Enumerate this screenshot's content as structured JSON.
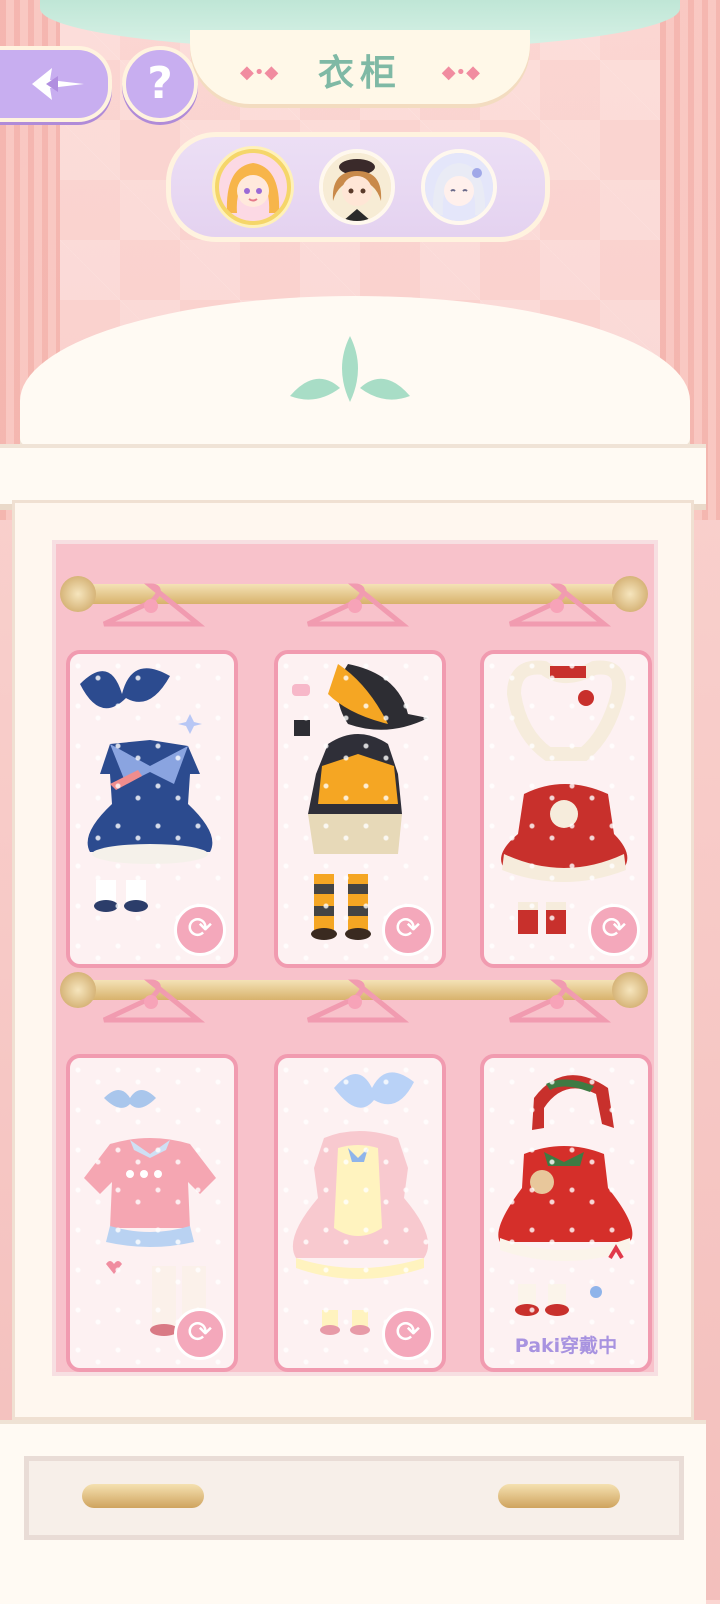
{
  "header": {
    "title": "衣柜"
  },
  "help": {
    "label": "?"
  },
  "avatars": [
    {
      "name": "blonde-girl",
      "selected": true
    },
    {
      "name": "brown-hair-boy",
      "selected": false
    },
    {
      "name": "silver-hair-girl",
      "selected": false
    }
  ],
  "outfits": [
    {
      "name": "navy-sailor-dress",
      "swap_icon": "refresh-icon"
    },
    {
      "name": "witch-halloween-dress",
      "swap_icon": "refresh-icon"
    },
    {
      "name": "red-bunny-winter-dress",
      "swap_icon": "refresh-icon"
    },
    {
      "name": "pink-sweater-outfit",
      "swap_icon": "refresh-icon"
    },
    {
      "name": "pink-apron-dress",
      "swap_icon": "refresh-icon"
    },
    {
      "name": "christmas-red-dress",
      "status": "Paki穿戴中"
    }
  ],
  "swap_glyph": "⟳",
  "colors": {
    "accent": "#c8aef0",
    "card_border": "#f19bb0",
    "title": "#7fb9a5"
  }
}
